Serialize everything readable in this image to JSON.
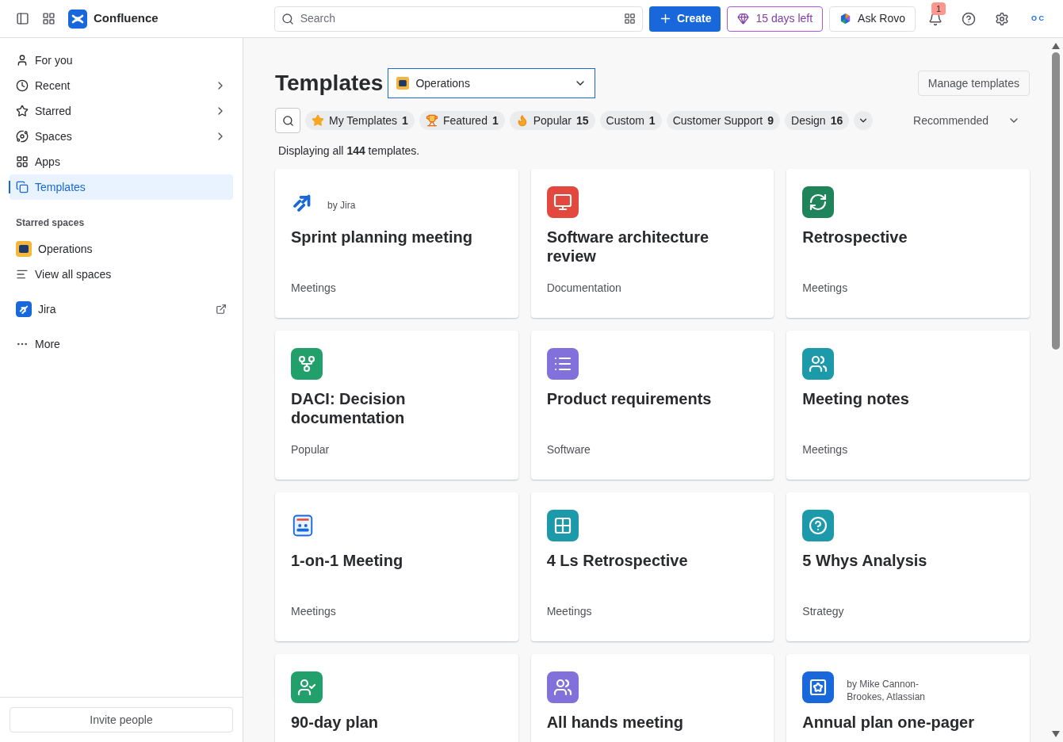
{
  "topbar": {
    "product": "Confluence",
    "search": {
      "placeholder": "Search"
    },
    "create": "Create",
    "trial": "15 days left",
    "ask": "Ask Rovo",
    "notifications": "1",
    "avatar": "O C"
  },
  "sidebar": {
    "items": [
      {
        "label": "For you",
        "kind": "user",
        "chevron": false,
        "selected": false
      },
      {
        "label": "Recent",
        "kind": "clock",
        "chevron": true,
        "selected": false
      },
      {
        "label": "Starred",
        "kind": "star",
        "chevron": true,
        "selected": false
      },
      {
        "label": "Spaces",
        "kind": "planet",
        "chevron": true,
        "selected": false
      },
      {
        "label": "Apps",
        "kind": "apps",
        "chevron": false,
        "selected": false
      },
      {
        "label": "Templates",
        "kind": "copy",
        "chevron": false,
        "selected": true
      }
    ],
    "section": "Starred spaces",
    "spaces": [
      {
        "label": "Operations",
        "kind": "space"
      },
      {
        "label": "View all spaces",
        "kind": "lines"
      }
    ],
    "jira": "Jira",
    "more": "More",
    "invite": "Invite people"
  },
  "header": {
    "title": "Templates",
    "space": "Operations",
    "manage": "Manage templates",
    "sort": "Recommended"
  },
  "filters": [
    {
      "label": "My Templates",
      "count": "1",
      "kind": "star"
    },
    {
      "label": "Featured",
      "count": "1",
      "kind": "trophy"
    },
    {
      "label": "Popular",
      "count": "15",
      "kind": "fire"
    },
    {
      "label": "Custom",
      "count": "1"
    },
    {
      "label": "Customer Support",
      "count": "9"
    },
    {
      "label": "Design",
      "count": "16"
    }
  ],
  "summary": "Displaying all **144** templates.",
  "cards": [
    {
      "title": "Sprint planning meeting",
      "author": "by Jira",
      "category": "Meetings",
      "kind": "jira"
    },
    {
      "title": "Software architecture review",
      "category": "Documentation",
      "kind": "monitor",
      "color": "#e2483d"
    },
    {
      "title": "Retrospective",
      "category": "Meetings",
      "kind": "cycle",
      "color": "#1f845a"
    },
    {
      "title": "DACI: Decision documentation",
      "category": "Popular",
      "kind": "fork",
      "color": "#22a06b"
    },
    {
      "title": "Product requirements",
      "category": "Software",
      "kind": "list",
      "color": "#8270db"
    },
    {
      "title": "Meeting notes",
      "category": "Meetings",
      "kind": "people",
      "color": "#1d9aaa"
    },
    {
      "title": "1-on-1 Meeting",
      "category": "Meetings",
      "kind": "board"
    },
    {
      "title": "4 Ls Retrospective",
      "category": "Meetings",
      "kind": "grid",
      "color": "#1d9aaa"
    },
    {
      "title": "5 Whys Analysis",
      "category": "Strategy",
      "kind": "question",
      "color": "#1d9aaa"
    },
    {
      "title": "90-day plan",
      "kind": "usercheck",
      "color": "#22a06b"
    },
    {
      "title": "All hands meeting",
      "kind": "people",
      "color": "#8270db"
    },
    {
      "title": "Annual plan one-pager",
      "author": "by Mike Cannon-Brookes, Atlassian",
      "kind": "starcard",
      "color": "#1868db"
    }
  ]
}
